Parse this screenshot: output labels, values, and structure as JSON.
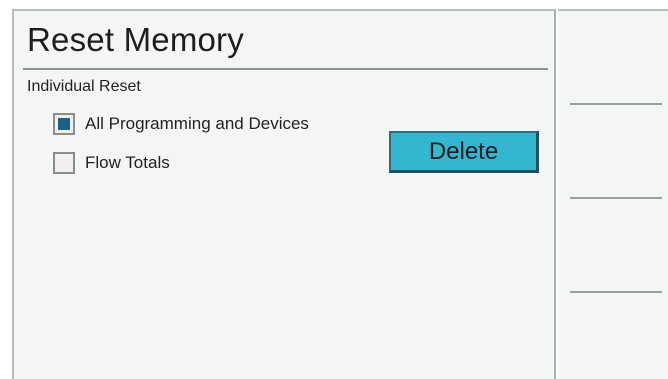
{
  "screen": {
    "title": "Reset Memory",
    "section_label": "Individual Reset",
    "options": [
      {
        "label": "All Programming and Devices",
        "checked": true
      },
      {
        "label": "Flow Totals",
        "checked": false
      }
    ],
    "delete_label": "Delete"
  },
  "softkeys": [
    {
      "label": ""
    },
    {
      "label": ""
    },
    {
      "label": ""
    },
    {
      "label": ""
    }
  ],
  "colors": {
    "panel_background": "#f3f6f5",
    "button_accent": "#35b6d0",
    "checkbox_fill": "#1a5f86"
  }
}
